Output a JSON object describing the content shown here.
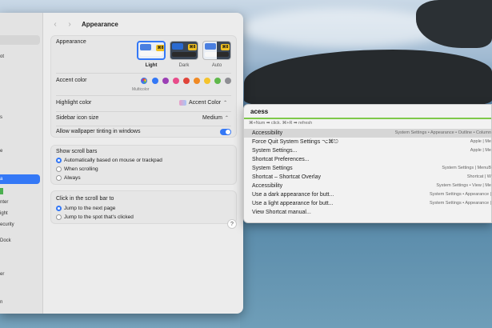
{
  "window": {
    "title": "Appearance"
  },
  "sidebar": {
    "items": [
      {
        "label": "ot"
      },
      {
        "label": "s"
      },
      {
        "label": "e"
      },
      {
        "label": "a"
      },
      {
        "label": "nter"
      },
      {
        "label": "ight"
      },
      {
        "label": "ecurity"
      },
      {
        "label": "Dock"
      },
      {
        "label": "er"
      },
      {
        "label": "n"
      }
    ]
  },
  "appearance": {
    "label": "Appearance",
    "options": [
      {
        "label": "Light",
        "key": "⌘8",
        "selected": true
      },
      {
        "label": "Dark",
        "key": "⌘8",
        "selected": false
      },
      {
        "label": "Auto",
        "key": "⌘8",
        "selected": false
      }
    ]
  },
  "accent": {
    "label": "Accent color",
    "selected_label": "Multicolor",
    "colors": [
      "multicolor",
      "#3478f6",
      "#9b3fb5",
      "#e84c8a",
      "#e0443a",
      "#f08a24",
      "#f5c32c",
      "#5fb84a",
      "#8e8e93"
    ]
  },
  "highlight": {
    "label": "Highlight color",
    "value": "Accent Color"
  },
  "sidebar_icon_size": {
    "label": "Sidebar icon size",
    "value": "Medium"
  },
  "wallpaper_tinting": {
    "label": "Allow wallpaper tinting in windows",
    "on": true
  },
  "scroll_bars": {
    "label": "Show scroll bars",
    "options": [
      {
        "label": "Automatically based on mouse or trackpad",
        "selected": true
      },
      {
        "label": "When scrolling",
        "selected": false
      },
      {
        "label": "Always",
        "selected": false
      }
    ]
  },
  "scroll_click": {
    "label": "Click in the scroll bar to",
    "options": [
      {
        "label": "Jump to the next page",
        "selected": true
      },
      {
        "label": "Jump to the spot that's clicked",
        "selected": false
      }
    ]
  },
  "help_label": "?",
  "palette": {
    "query": "acess",
    "hint": "⌘+Num ➡ click. ⌘+R ➡ refresh",
    "results": [
      {
        "label": "Accessibility",
        "path": "System Settings • Appearance • Outline • Column",
        "selected": true
      },
      {
        "label": "Force Quit System Settings ⌥⌘⎋",
        "path": "Apple | Me",
        "selected": false
      },
      {
        "label": "System Settings...",
        "path": "Apple | Me",
        "selected": false
      },
      {
        "label": "Shortcat Preferences...",
        "path": "",
        "selected": false
      },
      {
        "label": "System Settings",
        "path": "System Settings | MenuB",
        "selected": false
      },
      {
        "label": "Shortcat – Shortcat Overlay",
        "path": "Shortcat | W",
        "selected": false
      },
      {
        "label": "Accessibility",
        "path": "System Settings • View | Me",
        "selected": false
      },
      {
        "label": "Use a dark appearance for butt...",
        "path": "System Settings • Appearance |",
        "selected": false
      },
      {
        "label": "Use a light appearance for butt...",
        "path": "System Settings • Appearance |",
        "selected": false
      },
      {
        "label": "View Shortcat manual...",
        "path": "",
        "selected": false
      }
    ]
  }
}
